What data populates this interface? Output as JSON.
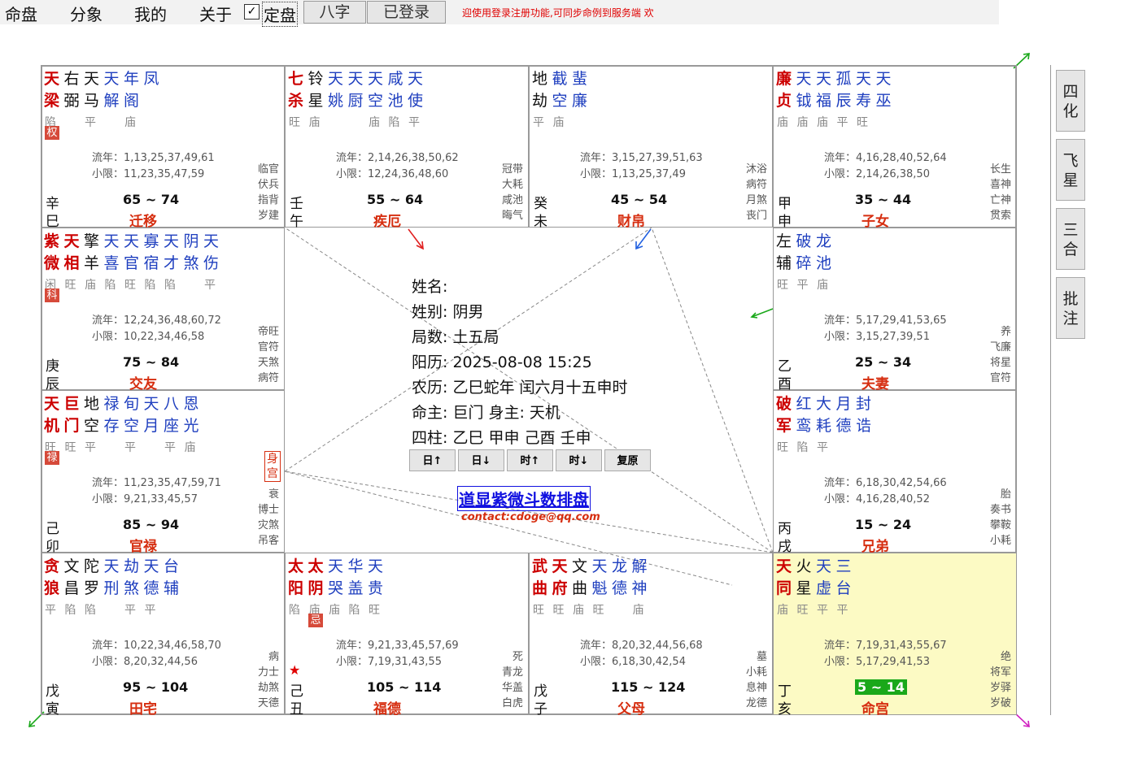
{
  "menu": {
    "items": [
      "命盘",
      "分象",
      "我的",
      "关于"
    ],
    "fixed_label": "定盘",
    "fixed_checked": true,
    "bazi_btn": "八字",
    "login_btn": "已登录"
  },
  "notice": "迎使用登录注册功能,可同步命例到服务端 欢",
  "palaces": [
    {
      "id": "si",
      "main": [
        "天梁"
      ],
      "minor": [
        "右弼",
        "天马"
      ],
      "misc": [
        "天解",
        "年阁",
        "凤"
      ],
      "brightness": [
        "陷",
        "",
        "平",
        "",
        "庙"
      ],
      "hua": "权",
      "liunian": "流年：1,13,25,37,49,61",
      "xiaoxian": "小限：11,23,35,47,59",
      "gods": [
        "临官",
        "伏兵",
        "指背",
        "岁建"
      ],
      "gan": "辛",
      "zhi": "巳",
      "daxian": "65 ~ 74",
      "name": "迁移",
      "shen": ""
    },
    {
      "id": "wu",
      "main": [
        "七杀"
      ],
      "minor": [
        "铃星"
      ],
      "misc": [
        "天姚",
        "天厨",
        "天空",
        "咸池",
        "天使"
      ],
      "brightness": [
        "旺",
        "庙",
        "",
        "",
        "庙",
        "陷",
        "平"
      ],
      "hua": "",
      "liunian": "流年：2,14,26,38,50,62",
      "xiaoxian": "小限：12,24,36,48,60",
      "gods": [
        "冠带",
        "大耗",
        "咸池",
        "晦气"
      ],
      "gan": "壬",
      "zhi": "午",
      "daxian": "55 ~ 64",
      "name": "疾厄",
      "shen": ""
    },
    {
      "id": "wei",
      "main": [],
      "minor": [
        "地劫"
      ],
      "misc": [
        "截空",
        "蜚廉"
      ],
      "brightness": [
        "平",
        "庙"
      ],
      "hua": "",
      "liunian": "流年：3,15,27,39,51,63",
      "xiaoxian": "小限：1,13,25,37,49",
      "gods": [
        "沐浴",
        "病符",
        "月煞",
        "丧门"
      ],
      "gan": "癸",
      "zhi": "未",
      "daxian": "45 ~ 54",
      "name": "财帛",
      "shen": ""
    },
    {
      "id": "shen",
      "main": [
        "廉贞"
      ],
      "minor": [],
      "misc": [
        "天钺",
        "天福",
        "孤辰",
        "天寿",
        "天巫"
      ],
      "brightness": [
        "庙",
        "庙",
        "庙",
        "平",
        "旺"
      ],
      "hua": "",
      "liunian": "流年：4,16,28,40,52,64",
      "xiaoxian": "小限：2,14,26,38,50",
      "gods": [
        "长生",
        "喜神",
        "亡神",
        "贯索"
      ],
      "gan": "甲",
      "zhi": "申",
      "daxian": "35 ~ 44",
      "name": "子女",
      "shen": ""
    },
    {
      "id": "chen",
      "main": [
        "紫微",
        "天相"
      ],
      "minor": [
        "擎羊"
      ],
      "misc": [
        "天喜",
        "天官",
        "寡宿",
        "天才",
        "阴煞",
        "天伤"
      ],
      "brightness": [
        "闲",
        "旺",
        "庙",
        "陷",
        "旺",
        "陷",
        "陷",
        "",
        "平"
      ],
      "hua": "科",
      "liunian": "流年：12,24,36,48,60,72",
      "xiaoxian": "小限：10,22,34,46,58",
      "gods": [
        "帝旺",
        "官符",
        "天煞",
        "病符"
      ],
      "gan": "庚",
      "zhi": "辰",
      "daxian": "75 ~ 84",
      "name": "交友",
      "shen": ""
    },
    {
      "id": "you",
      "main": [],
      "minor": [
        "左辅"
      ],
      "misc": [
        "破碎",
        "龙池"
      ],
      "brightness": [
        "旺",
        "平",
        "庙"
      ],
      "hua": "",
      "liunian": "流年：5,17,29,41,53,65",
      "xiaoxian": "小限：3,15,27,39,51",
      "gods": [
        "养",
        "飞廉",
        "将星",
        "官符"
      ],
      "gan": "乙",
      "zhi": "酉",
      "daxian": "25 ~ 34",
      "name": "夫妻",
      "shen": ""
    },
    {
      "id": "mao",
      "main": [
        "天机",
        "巨门"
      ],
      "minor": [
        "地空"
      ],
      "misc": [
        "禄存",
        "旬空",
        "天月",
        "八座",
        "恩光"
      ],
      "brightness": [
        "旺",
        "旺",
        "平",
        "",
        "平",
        "",
        "平",
        "庙"
      ],
      "hua": "禄",
      "liunian": "流年：11,23,35,47,59,71",
      "xiaoxian": "小限：9,21,33,45,57",
      "gods": [
        "衰",
        "博士",
        "灾煞",
        "吊客"
      ],
      "gan": "己",
      "zhi": "卯",
      "daxian": "85 ~ 94",
      "name": "官禄",
      "shen": "身宫"
    },
    {
      "id": "xu",
      "main": [
        "破军"
      ],
      "minor": [],
      "misc": [
        "红鸾",
        "大耗",
        "月德",
        "封诰"
      ],
      "brightness": [
        "旺",
        "陷",
        "平"
      ],
      "hua": "",
      "liunian": "流年：6,18,30,42,54,66",
      "xiaoxian": "小限：4,16,28,40,52",
      "gods": [
        "胎",
        "奏书",
        "攀鞍",
        "小耗"
      ],
      "gan": "丙",
      "zhi": "戌",
      "daxian": "15 ~ 24",
      "name": "兄弟",
      "shen": ""
    },
    {
      "id": "yin",
      "main": [
        "贪狼"
      ],
      "minor": [
        "文昌",
        "陀罗"
      ],
      "misc": [
        "天刑",
        "劫煞",
        "天德",
        "台辅"
      ],
      "brightness": [
        "平",
        "陷",
        "陷",
        "",
        "平",
        "平"
      ],
      "hua": "",
      "liunian": "流年：10,22,34,46,58,70",
      "xiaoxian": "小限：8,20,32,44,56",
      "gods": [
        "病",
        "力士",
        "劫煞",
        "天德"
      ],
      "gan": "戊",
      "zhi": "寅",
      "daxian": "95 ~ 104",
      "name": "田宅",
      "shen": ""
    },
    {
      "id": "chou",
      "main": [
        "太阳",
        "太阴"
      ],
      "minor": [],
      "misc": [
        "天哭",
        "华盖",
        "天贵"
      ],
      "brightness": [
        "陷",
        "庙",
        "庙",
        "陷",
        "旺"
      ],
      "hua": "忌",
      "liunian": "流年：9,21,33,45,57,69",
      "xiaoxian": "小限：7,19,31,43,55",
      "gods": [
        "死",
        "青龙",
        "华盖",
        "白虎"
      ],
      "gan": "己",
      "zhi": "丑",
      "daxian": "105 ~ 114",
      "name": "福德",
      "shen": "",
      "star_mark": "★"
    },
    {
      "id": "zi",
      "main": [
        "武曲",
        "天府"
      ],
      "minor": [
        "文曲"
      ],
      "misc": [
        "天魁",
        "龙德",
        "解神"
      ],
      "brightness": [
        "旺",
        "旺",
        "庙",
        "旺",
        "",
        "庙"
      ],
      "hua": "",
      "liunian": "流年：8,20,32,44,56,68",
      "xiaoxian": "小限：6,18,30,42,54",
      "gods": [
        "墓",
        "小耗",
        "息神",
        "龙德"
      ],
      "gan": "戊",
      "zhi": "子",
      "daxian": "115 ~ 124",
      "name": "父母",
      "shen": ""
    },
    {
      "id": "hai",
      "main": [
        "天同"
      ],
      "minor": [
        "火星"
      ],
      "misc": [
        "天虚",
        "三台"
      ],
      "brightness": [
        "庙",
        "旺",
        "平",
        "平"
      ],
      "hua": "",
      "liunian": "流年：7,19,31,43,55,67",
      "xiaoxian": "小限：5,17,29,41,53",
      "gods": [
        "绝",
        "将军",
        "岁驿",
        "岁破"
      ],
      "gan": "丁",
      "zhi": "亥",
      "daxian": "5 ~ 14",
      "name": "命宫",
      "shen": "",
      "highlight": true
    }
  ],
  "center": {
    "name": "姓名:",
    "gender": "姓别: 阴男",
    "ju": "局数: 土五局",
    "solar": "阳历: 2025-08-08 15:25",
    "lunar": "农历: 乙巳蛇年 闰六月十五申时",
    "ming": "命主: 巨门 身主: 天机",
    "sizhu": "四柱:  乙巳  甲申  己酉  壬申",
    "buttons": [
      "日↑",
      "日↓",
      "时↑",
      "时↓",
      "复原"
    ],
    "brand": "道显紫微斗数排盘",
    "contact": "contact:cdoge@qq.com"
  },
  "sidebar": [
    [
      "四",
      "化"
    ],
    [
      "飞",
      "星"
    ],
    [
      "三",
      "合"
    ],
    [
      "批",
      "注"
    ]
  ],
  "colors": {
    "main_star": "#cc0000",
    "misc_star": "#1f3fbf",
    "palace_name": "#d62e10",
    "highlight_bg": "#fcfac4",
    "daxian_highlight": "#1aa81a"
  }
}
